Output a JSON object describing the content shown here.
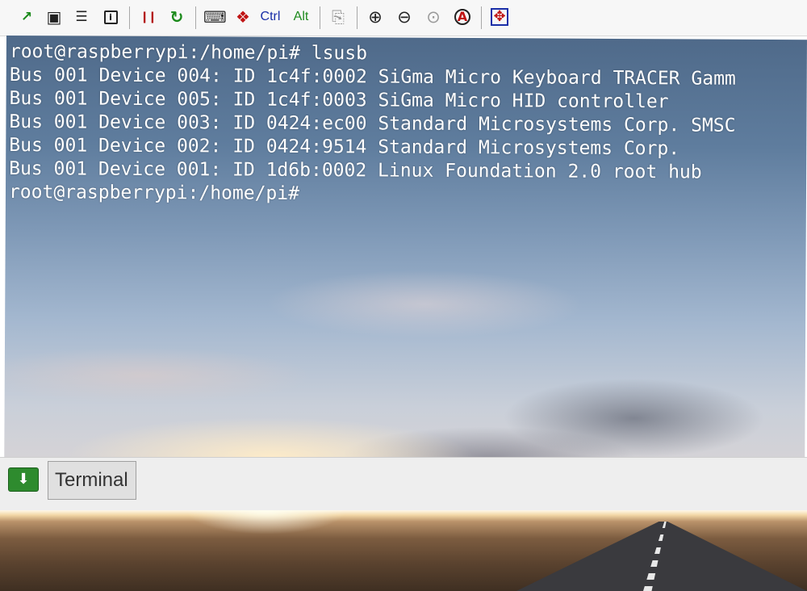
{
  "toolbar": {
    "buttons": [
      {
        "icon": "connection-icon",
        "glyph": "↗"
      },
      {
        "icon": "save-icon",
        "glyph": "▣"
      },
      {
        "icon": "options-icon",
        "glyph": "☰"
      },
      {
        "icon": "info-icon",
        "glyph": "i"
      },
      {
        "icon": "pause-icon",
        "glyph": "❙❙"
      },
      {
        "icon": "refresh-icon",
        "glyph": "↻"
      },
      {
        "icon": "keyboard-icon",
        "glyph": "⌨"
      },
      {
        "icon": "windows-key-icon",
        "glyph": "❖"
      },
      {
        "icon": "copy-icon",
        "glyph": "⎘"
      },
      {
        "icon": "zoom-in-icon",
        "glyph": "⊕"
      },
      {
        "icon": "zoom-out-icon",
        "glyph": "⊖"
      },
      {
        "icon": "zoom-fit-icon",
        "glyph": "⊙"
      },
      {
        "icon": "zoom-auto-icon",
        "glyph": "A"
      },
      {
        "icon": "fullscreen-icon",
        "glyph": "✥"
      }
    ],
    "ctrl_label": "Ctrl",
    "alt_label": "Alt",
    "colors": {
      "ctrl": "#1a2fa8",
      "alt": "#1d8a1d",
      "pause": "#b31010",
      "refresh": "#1b8a1b",
      "fullscreen": "#c01414"
    }
  },
  "terminal": {
    "lines": [
      "root@raspberrypi:/home/pi# lsusb",
      "Bus 001 Device 004: ID 1c4f:0002 SiGma Micro Keyboard TRACER Gamm",
      "Bus 001 Device 005: ID 1c4f:0003 SiGma Micro HID controller",
      "Bus 001 Device 003: ID 0424:ec00 Standard Microsystems Corp. SMSC",
      "Bus 001 Device 002: ID 0424:9514 Standard Microsystems Corp.",
      "Bus 001 Device 001: ID 1d6b:0002 Linux Foundation 2.0 root hub",
      "root@raspberrypi:/home/pi#"
    ]
  },
  "taskbar": {
    "menu_icon": "download-arrow-icon",
    "menu_glyph": "⬇",
    "task_label": "Terminal"
  }
}
